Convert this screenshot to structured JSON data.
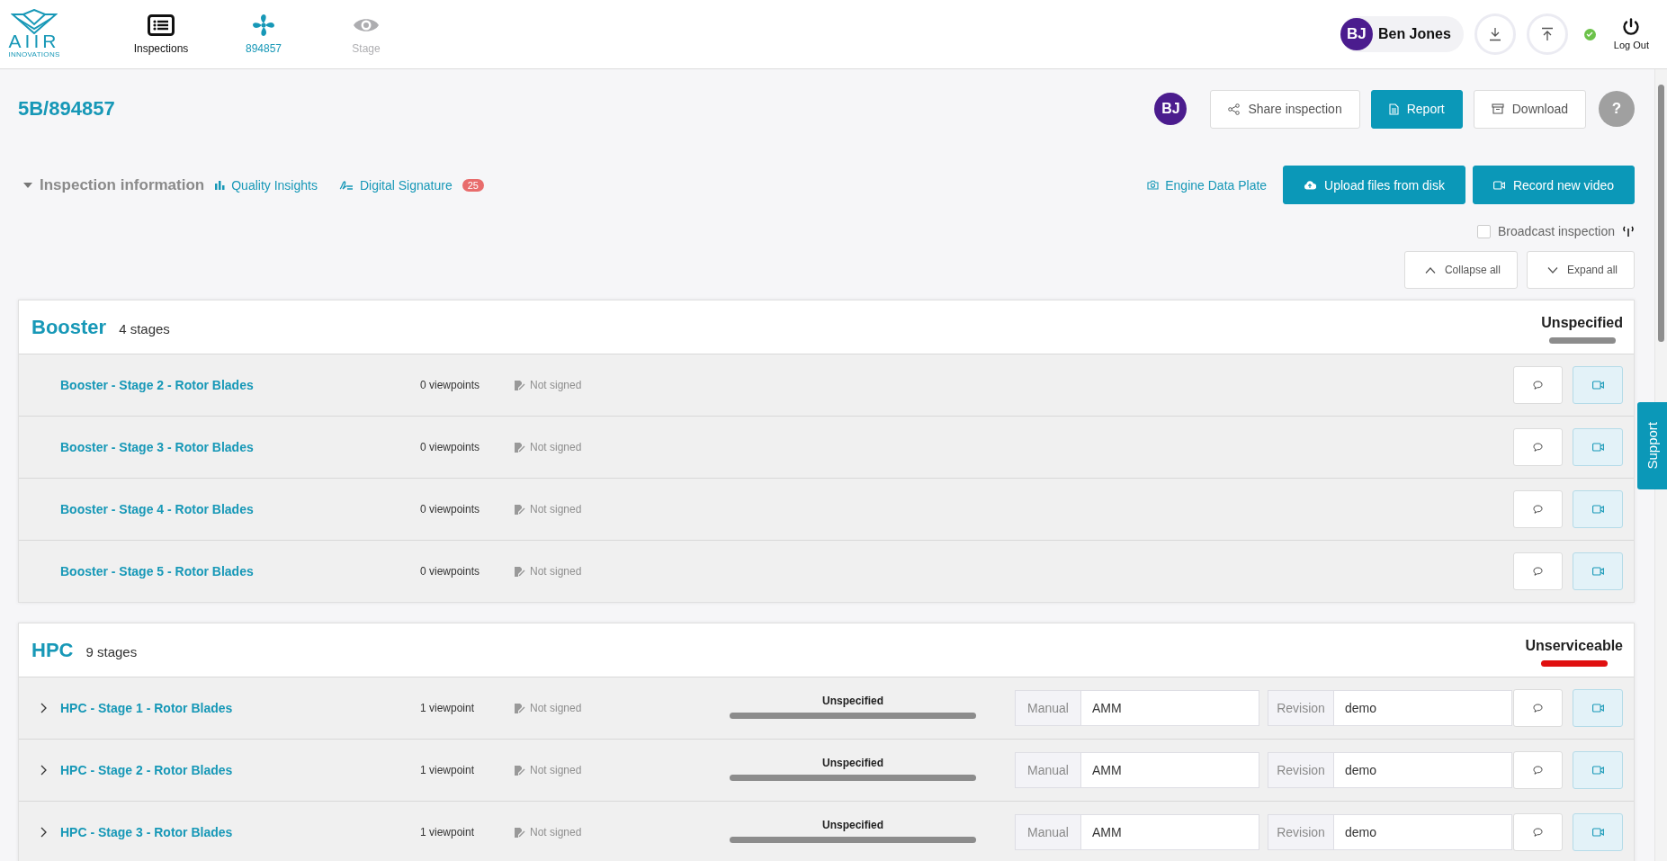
{
  "logo": {
    "name": "AIIR",
    "subtitle": "INNOVATIONS"
  },
  "nav": [
    {
      "label": "Inspections",
      "kind": "list",
      "selected": false,
      "disabled": false
    },
    {
      "label": "894857",
      "kind": "fan",
      "selected": true,
      "disabled": false
    },
    {
      "label": "Stage",
      "kind": "eye",
      "selected": false,
      "disabled": true
    }
  ],
  "user": {
    "initials": "BJ",
    "name": "Ben Jones",
    "online": true,
    "logout": "Log Out"
  },
  "page": {
    "title": "5B/894857",
    "collaborator": "BJ",
    "help": "?",
    "actions": [
      {
        "label": "Share inspection",
        "kind": "share",
        "primary": false
      },
      {
        "label": "Report",
        "kind": "report",
        "primary": true
      },
      {
        "label": "Download",
        "kind": "archive",
        "primary": false
      }
    ]
  },
  "info": {
    "label": "Inspection information",
    "quality": "Quality Insights",
    "signature": "Digital Signature",
    "signature_count": "25",
    "plate": "Engine Data Plate",
    "buttons": [
      {
        "label": "Upload files from disk",
        "kind": "upload"
      },
      {
        "label": "Record new video",
        "kind": "video"
      }
    ]
  },
  "broadcast": {
    "label": "Broadcast inspection",
    "checked": false
  },
  "toggles": [
    {
      "label": "Collapse all",
      "kind": "up"
    },
    {
      "label": "Expand all",
      "kind": "down"
    }
  ],
  "sections": [
    {
      "name": "Booster",
      "count": "4 stages",
      "status": {
        "label": "Unspecified",
        "color": "#8c8c8c"
      },
      "stages": [
        {
          "name": "Booster - Stage 2 - Rotor Blades",
          "viewpoints": "0 viewpoints",
          "signature": "Not signed",
          "expandable": false
        },
        {
          "name": "Booster - Stage 3 - Rotor Blades",
          "viewpoints": "0 viewpoints",
          "signature": "Not signed",
          "expandable": false
        },
        {
          "name": "Booster - Stage 4 - Rotor Blades",
          "viewpoints": "0 viewpoints",
          "signature": "Not signed",
          "expandable": false
        },
        {
          "name": "Booster - Stage 5 - Rotor Blades",
          "viewpoints": "0 viewpoints",
          "signature": "Not signed",
          "expandable": false
        }
      ]
    },
    {
      "name": "HPC",
      "count": "9 stages",
      "status": {
        "label": "Unserviceable",
        "color": "#e01010"
      },
      "stages": [
        {
          "name": "HPC - Stage 1 - Rotor Blades",
          "viewpoints": "1 viewpoint",
          "signature": "Not signed",
          "expandable": true,
          "status": {
            "label": "Unspecified",
            "color": "#8c8c8c"
          },
          "manual_label": "Manual",
          "manual": "AMM",
          "revision_label": "Revision",
          "revision": "demo"
        },
        {
          "name": "HPC - Stage 2 - Rotor Blades",
          "viewpoints": "1 viewpoint",
          "signature": "Not signed",
          "expandable": true,
          "status": {
            "label": "Unspecified",
            "color": "#8c8c8c"
          },
          "manual_label": "Manual",
          "manual": "AMM",
          "revision_label": "Revision",
          "revision": "demo"
        },
        {
          "name": "HPC - Stage 3 - Rotor Blades",
          "viewpoints": "1 viewpoint",
          "signature": "Not signed",
          "expandable": true,
          "status": {
            "label": "Unspecified",
            "color": "#8c8c8c"
          },
          "manual_label": "Manual",
          "manual": "AMM",
          "revision_label": "Revision",
          "revision": "demo"
        }
      ]
    }
  ],
  "support": "Support"
}
